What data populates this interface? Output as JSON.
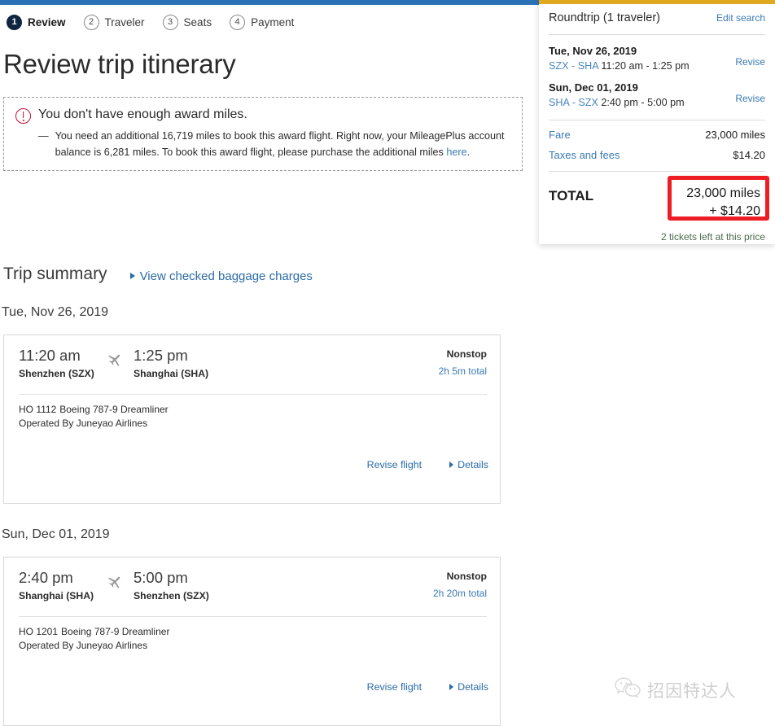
{
  "theme": {
    "top_bar_color": "#2a72b5",
    "gold_bar_color": "#e0a81f",
    "link_color": "#2a6ca8",
    "warning_color": "#cc0d2e",
    "annotation_color": "#ee1c25",
    "active_step_color": "#10253f"
  },
  "steps": [
    {
      "number": "1",
      "label": "Review",
      "active": true
    },
    {
      "number": "2",
      "label": "Traveler",
      "active": false
    },
    {
      "number": "3",
      "label": "Seats",
      "active": false
    },
    {
      "number": "4",
      "label": "Payment",
      "active": false
    }
  ],
  "page_title": "Review trip itinerary",
  "warning": {
    "icon": "alert-circle-icon",
    "title": "You don't have enough award miles.",
    "dash": "—",
    "body_before_link": "You need an additional 16,719 miles to book this award flight. Right now, your MileagePlus account balance is 6,281 miles. To book this award flight, please purchase the additional miles ",
    "link_text": "here",
    "body_after_link": "."
  },
  "trip_summary": {
    "title": "Trip summary",
    "baggage_link": "View checked baggage charges"
  },
  "segments": [
    {
      "date_heading": "Tue, Nov 26, 2019",
      "depart_time": "11:20 am",
      "depart_city": "Shenzhen (SZX)",
      "arrive_time": "1:25 pm",
      "arrive_city": "Shanghai (SHA)",
      "stops": "Nonstop",
      "duration": "2h 5m total",
      "flight_number": "HO 1112",
      "aircraft": "Boeing 787-9 Dreamliner",
      "operated_by": "Operated By Juneyao Airlines",
      "revise_label": "Revise flight",
      "details_label": "Details"
    },
    {
      "date_heading": "Sun, Dec 01, 2019",
      "depart_time": "2:40 pm",
      "depart_city": "Shanghai (SHA)",
      "arrive_time": "5:00 pm",
      "arrive_city": "Shenzhen (SZX)",
      "stops": "Nonstop",
      "duration": "2h 20m total",
      "flight_number": "HO 1201",
      "aircraft": "Boeing 787-9 Dreamliner",
      "operated_by": "Operated By Juneyao Airlines",
      "revise_label": "Revise flight",
      "details_label": "Details"
    }
  ],
  "side_panel": {
    "title": "Roundtrip (1 traveler)",
    "edit_search": "Edit search",
    "itinerary": [
      {
        "date": "Tue, Nov 26, 2019",
        "route_from": "SZX",
        "route_sep": " - ",
        "route_to": "SHA",
        "times": " 11:20 am - 1:25 pm",
        "revise": "Revise"
      },
      {
        "date": "Sun, Dec 01, 2019",
        "route_from": "SHA",
        "route_sep": " - ",
        "route_to": "SZX",
        "times": " 2:40 pm - 5:00 pm",
        "revise": "Revise"
      }
    ],
    "price_lines": [
      {
        "label": "Fare",
        "value": "23,000 miles"
      },
      {
        "label": "Taxes and fees",
        "value": "$14.20"
      }
    ],
    "total_label": "TOTAL",
    "total_miles": "23,000 miles",
    "total_cash": "+ $14.20",
    "tickets_left": "2 tickets left at this price"
  },
  "watermark": {
    "icon": "wechat-icon",
    "text": "招因特达人"
  }
}
